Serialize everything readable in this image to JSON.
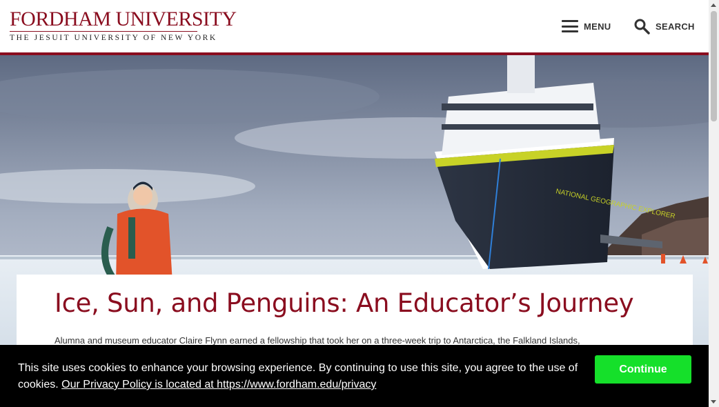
{
  "header": {
    "logo_title": "FORDHAM UNIVERSITY",
    "logo_subtitle": "THE JESUIT UNIVERSITY OF NEW YORK",
    "menu_label": "MENU",
    "search_label": "SEARCH"
  },
  "hero": {
    "ship_hull_text": "NATIONAL GEOGRAPHIC EXPLORER"
  },
  "article": {
    "title": "Ice, Sun, and Penguins: An Educator’s Journey",
    "summary": "Alumna and museum educator Claire Flynn earned a fellowship that took her on a three-week trip to Antarctica, the Falkland Islands,"
  },
  "cookie_banner": {
    "message": "This site uses cookies to enhance your browsing experience. By continuing to use this site, you agree to the use of cookies.",
    "link_text": "Our Privacy Policy is located at https://www.fordham.edu/privacy",
    "button_label": "Continue"
  },
  "colors": {
    "brand": "#8a0d1f",
    "cookie_button": "#15e02a",
    "cookie_background": "#000000"
  },
  "icons": [
    "hamburger-icon",
    "search-icon",
    "scroll-up-icon",
    "scroll-down-icon"
  ]
}
